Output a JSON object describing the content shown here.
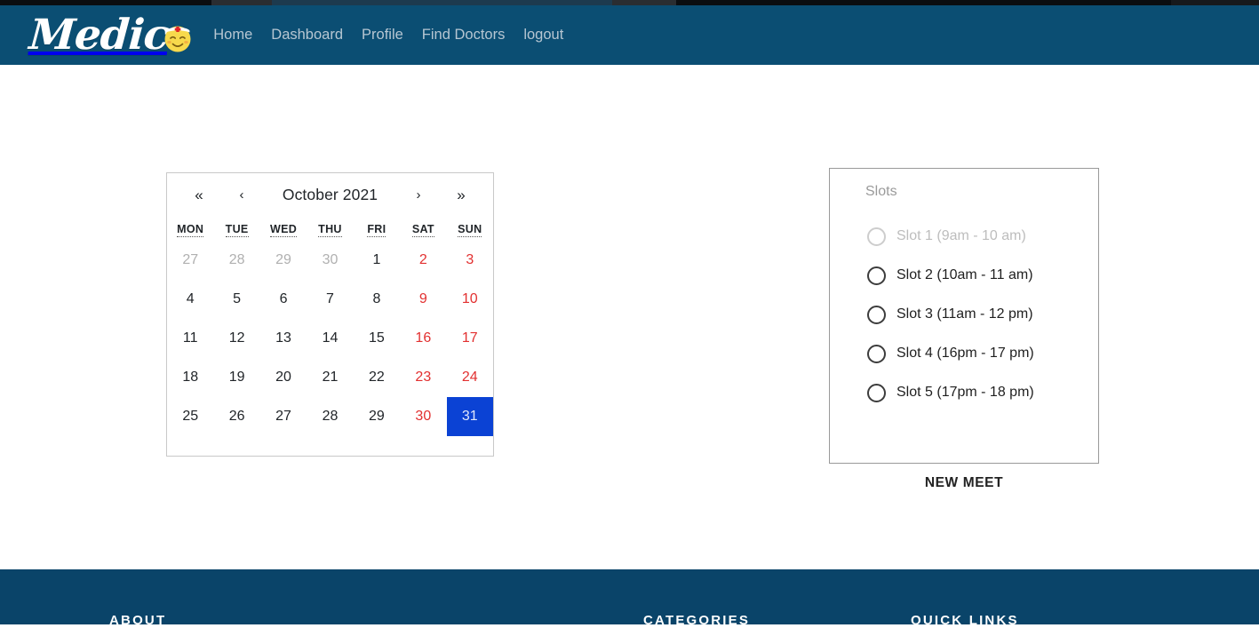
{
  "brand": {
    "word": "Medic",
    "face_icon": "nurse-face-icon"
  },
  "nav": {
    "links": [
      {
        "label": "Home"
      },
      {
        "label": "Dashboard"
      },
      {
        "label": "Profile"
      },
      {
        "label": "Find Doctors"
      },
      {
        "label": "logout"
      }
    ]
  },
  "calendar": {
    "title": "October 2021",
    "nav": {
      "first": "«",
      "prev": "‹",
      "next": "›",
      "last": "»"
    },
    "weekdays": [
      "MON",
      "TUE",
      "WED",
      "THU",
      "FRI",
      "SAT",
      "SUN"
    ],
    "weeks": [
      [
        {
          "day": "27",
          "state": "muted"
        },
        {
          "day": "28",
          "state": "muted"
        },
        {
          "day": "29",
          "state": "muted"
        },
        {
          "day": "30",
          "state": "muted"
        },
        {
          "day": "1",
          "state": "normal"
        },
        {
          "day": "2",
          "state": "weekend"
        },
        {
          "day": "3",
          "state": "weekend"
        }
      ],
      [
        {
          "day": "4",
          "state": "normal"
        },
        {
          "day": "5",
          "state": "normal"
        },
        {
          "day": "6",
          "state": "normal"
        },
        {
          "day": "7",
          "state": "normal"
        },
        {
          "day": "8",
          "state": "normal"
        },
        {
          "day": "9",
          "state": "weekend"
        },
        {
          "day": "10",
          "state": "weekend"
        }
      ],
      [
        {
          "day": "11",
          "state": "normal"
        },
        {
          "day": "12",
          "state": "normal"
        },
        {
          "day": "13",
          "state": "normal"
        },
        {
          "day": "14",
          "state": "normal"
        },
        {
          "day": "15",
          "state": "normal"
        },
        {
          "day": "16",
          "state": "weekend"
        },
        {
          "day": "17",
          "state": "weekend"
        }
      ],
      [
        {
          "day": "18",
          "state": "normal"
        },
        {
          "day": "19",
          "state": "normal"
        },
        {
          "day": "20",
          "state": "normal"
        },
        {
          "day": "21",
          "state": "normal"
        },
        {
          "day": "22",
          "state": "normal"
        },
        {
          "day": "23",
          "state": "weekend"
        },
        {
          "day": "24",
          "state": "weekend"
        }
      ],
      [
        {
          "day": "25",
          "state": "normal"
        },
        {
          "day": "26",
          "state": "normal"
        },
        {
          "day": "27",
          "state": "normal"
        },
        {
          "day": "28",
          "state": "normal"
        },
        {
          "day": "29",
          "state": "normal"
        },
        {
          "day": "30",
          "state": "weekend"
        },
        {
          "day": "31",
          "state": "selected"
        }
      ]
    ],
    "selected_day": "31",
    "selected_color": "#0b42d4"
  },
  "slots_panel": {
    "title": "Slots",
    "slots": [
      {
        "label": "Slot 1 (9am - 10 am)",
        "disabled": true,
        "selected": false
      },
      {
        "label": "Slot 2 (10am - 11 am)",
        "disabled": false,
        "selected": false
      },
      {
        "label": "Slot 3 (11am - 12 pm)",
        "disabled": false,
        "selected": false
      },
      {
        "label": "Slot 4 (16pm - 17 pm)",
        "disabled": false,
        "selected": false
      },
      {
        "label": "Slot 5 (17pm - 18 pm)",
        "disabled": false,
        "selected": false
      }
    ],
    "new_meet_label": "NEW MEET"
  },
  "footer": {
    "columns": [
      {
        "heading": "ABOUT"
      },
      {
        "heading": "CATEGORIES"
      },
      {
        "heading": "QUICK LINKS"
      }
    ]
  },
  "colors": {
    "navbar": "#0b4e73",
    "footer": "#0a4469",
    "accent_selected": "#0b42d4",
    "weekend_text": "#e23030",
    "nav_link": "#b6c6d2"
  }
}
